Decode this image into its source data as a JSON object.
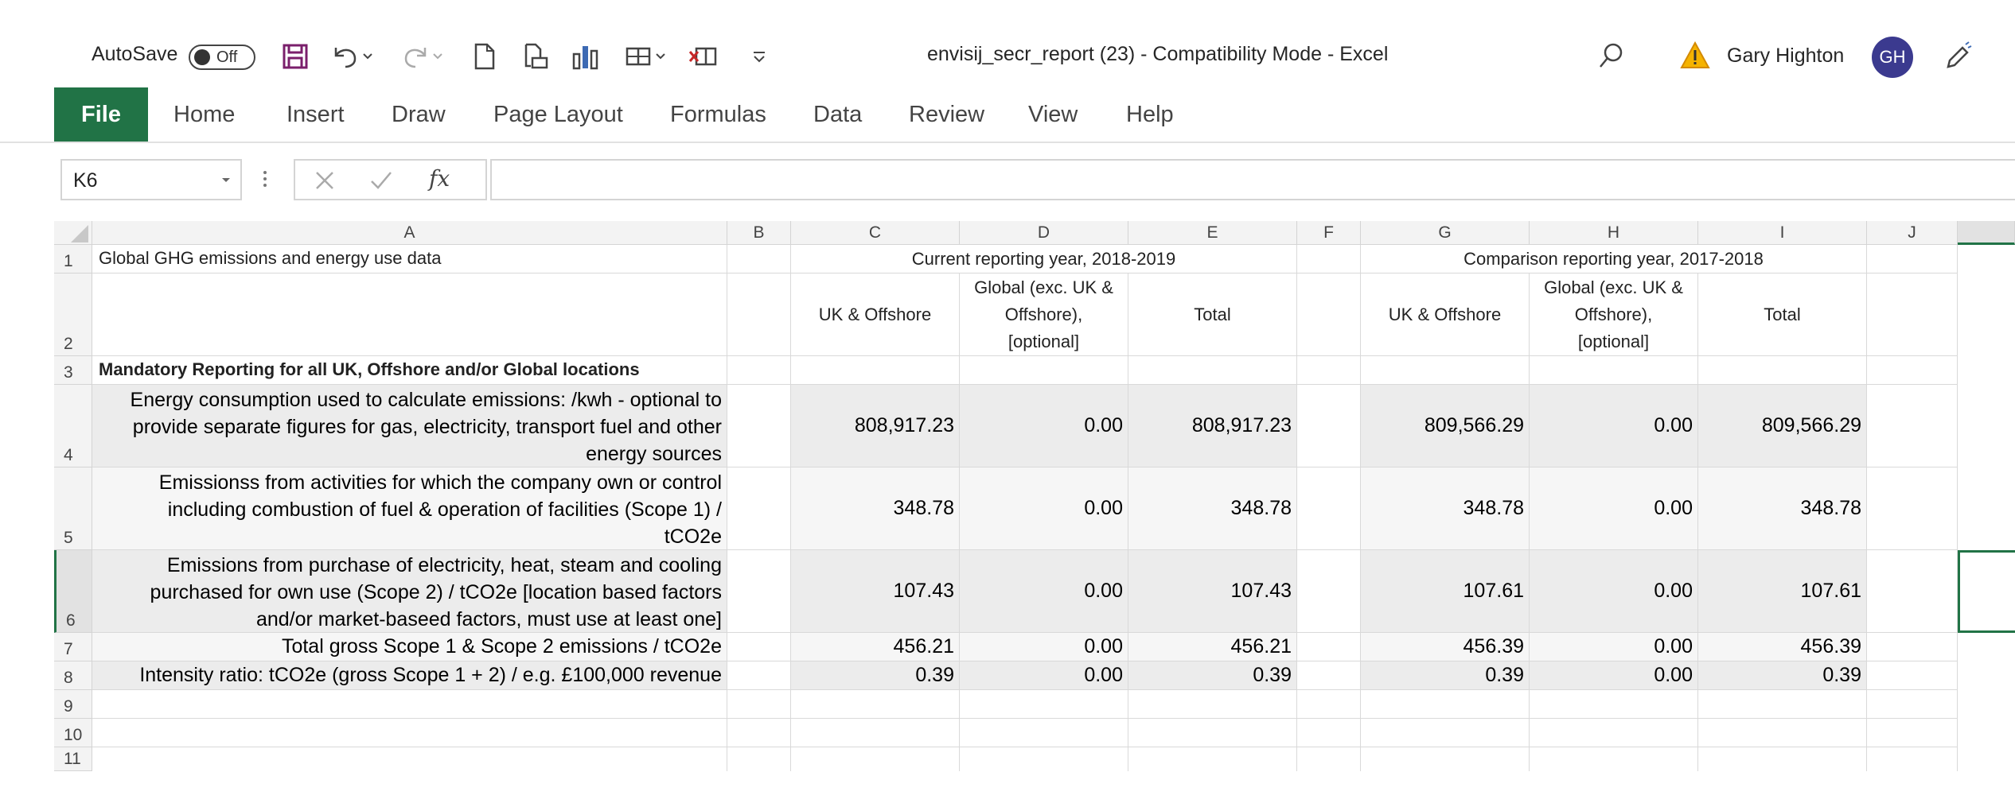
{
  "titlebar": {
    "autosave_label": "AutoSave",
    "autosave_state": "Off",
    "doc_title": "envisij_secr_report (23)  -  Compatibility Mode  -  Excel",
    "user_name": "Gary Highton",
    "user_initials": "GH"
  },
  "ribbon": {
    "tabs": [
      "File",
      "Home",
      "Insert",
      "Draw",
      "Page Layout",
      "Formulas",
      "Data",
      "Review",
      "View",
      "Help"
    ]
  },
  "formula_bar": {
    "name_box": "K6",
    "fx": "fx",
    "value": ""
  },
  "sheet": {
    "columns": [
      "A",
      "B",
      "C",
      "D",
      "E",
      "F",
      "G",
      "H",
      "I",
      "J"
    ],
    "rows": [
      "1",
      "2",
      "3",
      "4",
      "5",
      "6",
      "7",
      "8",
      "9",
      "10",
      "11"
    ],
    "a1": "Global GHG emissions and energy use data",
    "current_year_header": "Current reporting year, 2018-2019",
    "comparison_year_header": "Comparison reporting year, 2017-2018",
    "col_uk": "UK & Offshore",
    "col_global": "Global (exc. UK & Offshore), [optional]",
    "col_total": "Total",
    "a3": "Mandatory Reporting for all UK, Offshore and/or Global locations",
    "data_rows": [
      {
        "label": "Energy consumption used to calculate emissions: /kwh - optional to provide separate figures for gas, electricity, transport fuel and other energy sources",
        "c": "808,917.23",
        "d": "0.00",
        "e": "808,917.23",
        "g": "809,566.29",
        "h": "0.00",
        "i": "809,566.29"
      },
      {
        "label": "Emissionss from activities for which the company own or control including combustion of fuel & operation of facilities (Scope 1) / tCO2e",
        "c": "348.78",
        "d": "0.00",
        "e": "348.78",
        "g": "348.78",
        "h": "0.00",
        "i": "348.78"
      },
      {
        "label": "Emissions from purchase of electricity, heat, steam and cooling purchased for own use (Scope 2) / tCO2e [location based factors and/or market-baseed factors, must use at least one]",
        "c": "107.43",
        "d": "0.00",
        "e": "107.43",
        "g": "107.61",
        "h": "0.00",
        "i": "107.61"
      },
      {
        "label": "Total gross Scope 1 & Scope 2 emissions / tCO2e",
        "c": "456.21",
        "d": "0.00",
        "e": "456.21",
        "g": "456.39",
        "h": "0.00",
        "i": "456.39"
      },
      {
        "label": "Intensity ratio: tCO2e (gross Scope 1 + 2) / e.g. £100,000 revenue",
        "c": "0.39",
        "d": "0.00",
        "e": "0.39",
        "g": "0.39",
        "h": "0.00",
        "i": "0.39"
      }
    ]
  },
  "colors": {
    "file_tab": "#217346",
    "avatar": "#3b3a8f",
    "warning": "#e8a317",
    "save_icon": "#7a1f6b"
  }
}
